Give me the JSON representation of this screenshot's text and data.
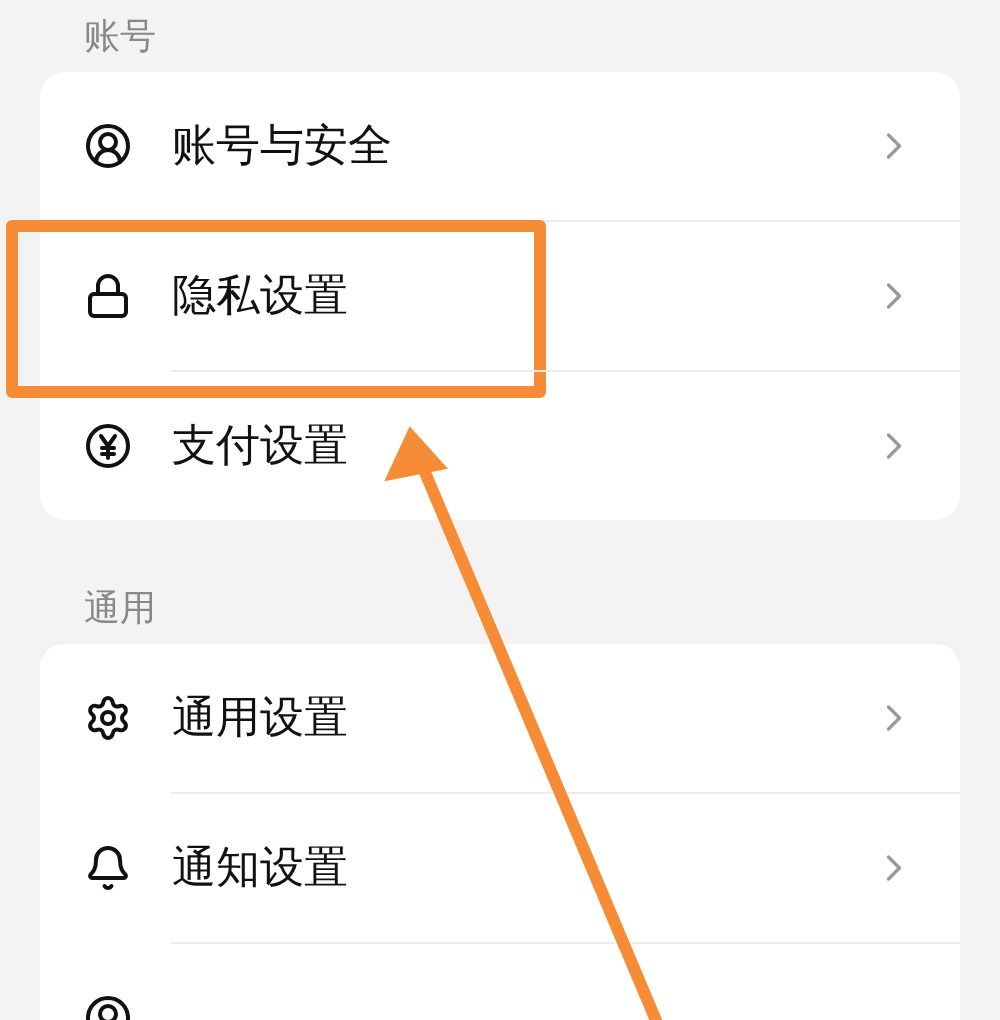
{
  "sections": [
    {
      "title": "账号",
      "items": [
        {
          "kind": "account",
          "label": "账号与安全",
          "highlighted": false
        },
        {
          "kind": "lock",
          "label": "隐私设置",
          "highlighted": true
        },
        {
          "kind": "yen",
          "label": "支付设置",
          "highlighted": false
        }
      ]
    },
    {
      "title": "通用",
      "items": [
        {
          "kind": "gear",
          "label": "通用设置",
          "highlighted": false
        },
        {
          "kind": "bell",
          "label": "通知设置",
          "highlighted": false
        },
        {
          "kind": "account"
        }
      ]
    }
  ]
}
